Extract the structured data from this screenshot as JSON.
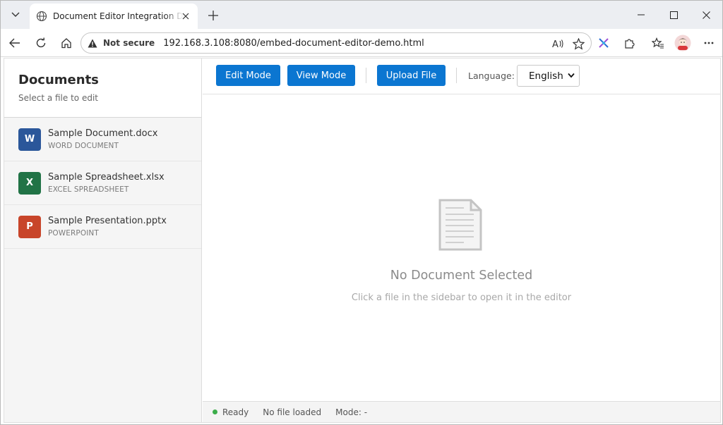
{
  "browser": {
    "tab_title": "Document Editor Integration Demo",
    "security_label": "Not secure",
    "url": "192.168.3.108:8080/embed-document-editor-demo.html"
  },
  "sidebar": {
    "title": "Documents",
    "subtitle": "Select a file to edit",
    "files": [
      {
        "badge": "W",
        "name": "Sample Document.docx",
        "type": "WORD DOCUMENT",
        "color": "#2b579a"
      },
      {
        "badge": "X",
        "name": "Sample Spreadsheet.xlsx",
        "type": "EXCEL SPREADSHEET",
        "color": "#217346"
      },
      {
        "badge": "P",
        "name": "Sample Presentation.pptx",
        "type": "POWERPOINT",
        "color": "#c8452a"
      }
    ]
  },
  "toolbar": {
    "edit_label": "Edit Mode",
    "view_label": "View Mode",
    "upload_label": "Upload File",
    "language_label": "Language:",
    "language_value": "English"
  },
  "empty_state": {
    "title": "No Document Selected",
    "subtitle": "Click a file in the sidebar to open it in the editor"
  },
  "status": {
    "state": "Ready",
    "file": "No file loaded",
    "mode": "Mode: -"
  },
  "colors": {
    "accent": "#0b76d1",
    "ready": "#3cad4a"
  }
}
